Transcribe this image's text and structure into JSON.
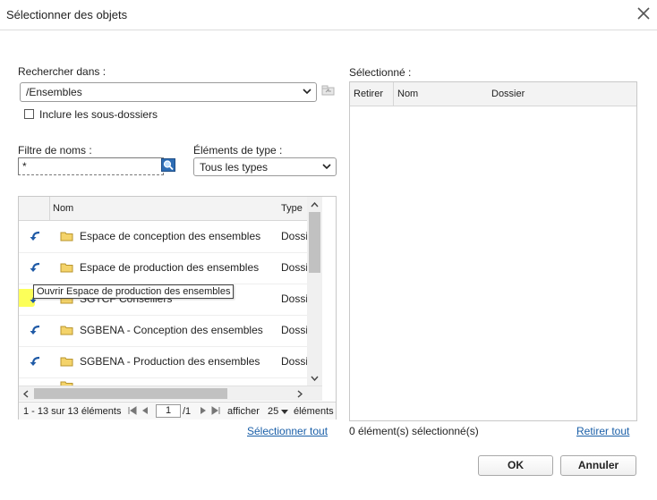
{
  "dialog": {
    "title": "Sélectionner des objets",
    "close_icon": "close-icon"
  },
  "search": {
    "label": "Rechercher dans :",
    "value": "/Ensembles",
    "include_subfolders_label": "Inclure les sous-dossiers",
    "include_subfolders_checked": false
  },
  "filter": {
    "label": "Filtre de noms :",
    "value": "*"
  },
  "type_filter": {
    "label": "Éléments de type :",
    "value": "Tous les types"
  },
  "grid": {
    "col_name": "Nom",
    "col_type": "Type",
    "rows": [
      {
        "name": "Espace de conception des ensembles",
        "type": "Dossi"
      },
      {
        "name": "Espace de production des ensembles",
        "type": "Dossi"
      },
      {
        "name": "SGTCF Conseillers",
        "type": "Dossi"
      },
      {
        "name": "SGBENA - Conception des ensembles",
        "type": "Dossi"
      },
      {
        "name": "SGBENA - Production des ensembles",
        "type": "Dossi"
      }
    ],
    "tooltip": "Ouvrir Espace de production des ensembles",
    "pager": {
      "range": "1 - 13 sur 13 éléments",
      "page": "1",
      "total": "/1",
      "show_label": "afficher",
      "page_size": "25",
      "items_label": "éléments"
    },
    "select_all": "Sélectionner tout"
  },
  "selected": {
    "label": "Sélectionné :",
    "col_remove": "Retirer",
    "col_name": "Nom",
    "col_folder": "Dossier",
    "count_text": "0 élément(s) sélectionné(s)",
    "remove_all": "Retirer tout"
  },
  "buttons": {
    "ok": "OK",
    "cancel": "Annuler"
  },
  "colors": {
    "link": "#1a5fa8",
    "folder": "#f4d36a",
    "highlight": "#fbff00",
    "arrow": "#1f5aa6"
  }
}
